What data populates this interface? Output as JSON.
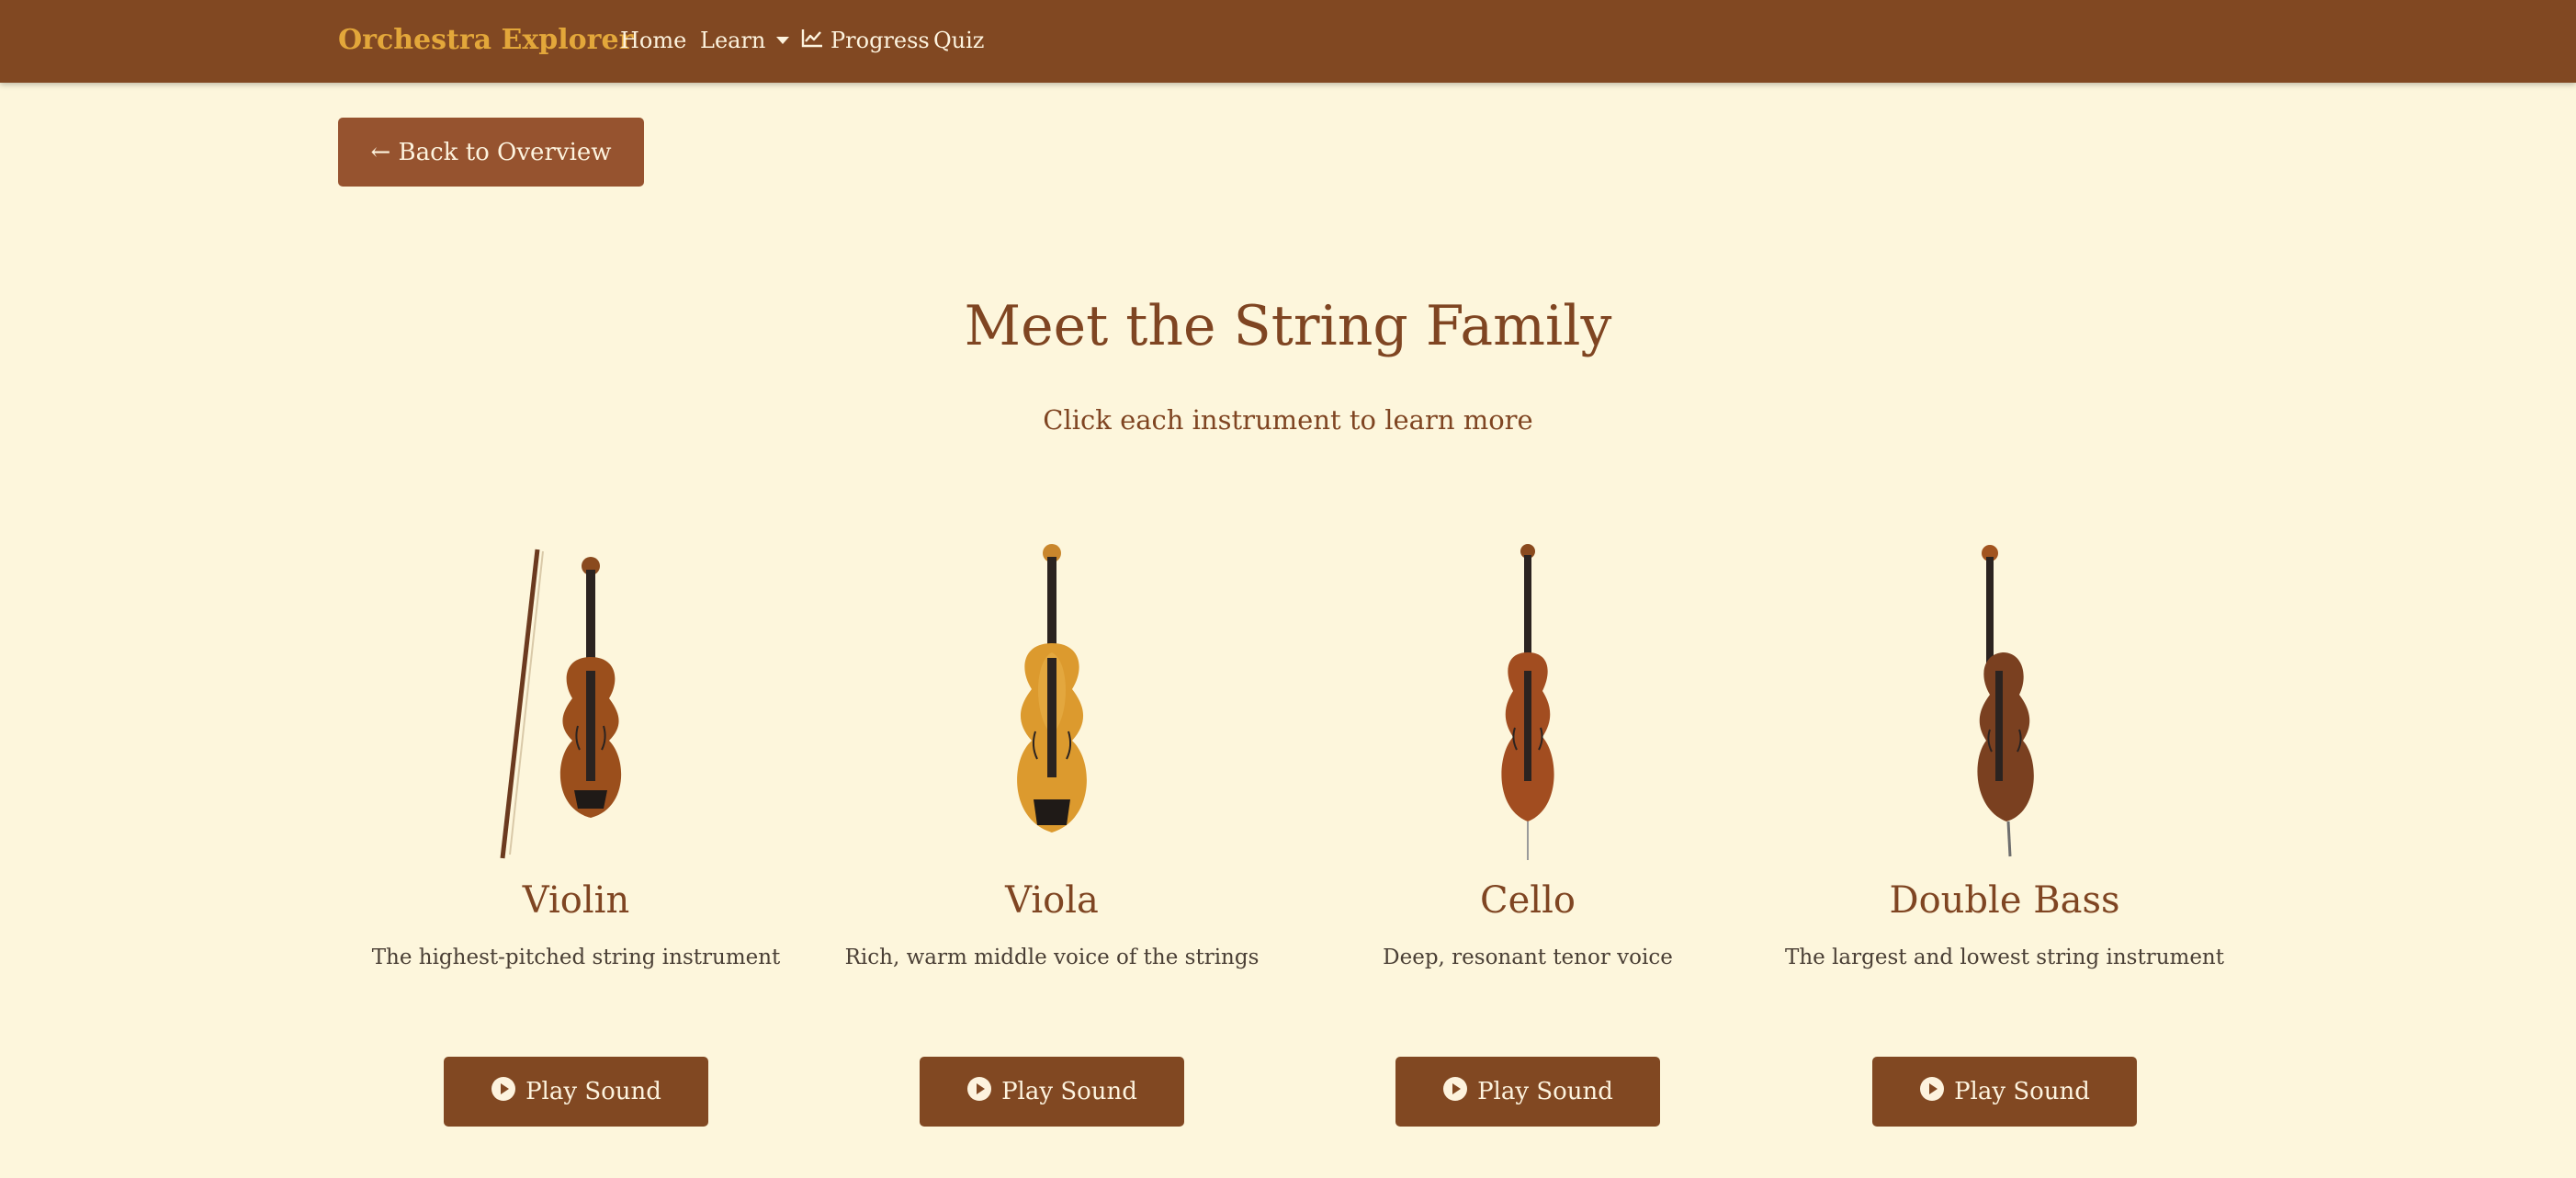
{
  "nav": {
    "brand": "Orchestra Explorer",
    "home": "Home",
    "learn": "Learn",
    "progress": "Progress",
    "quiz": "Quiz"
  },
  "back_button": "← Back to Overview",
  "title": "Meet the String Family",
  "subtitle": "Click each instrument to learn more",
  "play_label": "Play Sound",
  "instruments": [
    {
      "name": "Violin",
      "description": "The highest-pitched string instrument"
    },
    {
      "name": "Viola",
      "description": "Rich, warm middle voice of the strings"
    },
    {
      "name": "Cello",
      "description": "Deep, resonant tenor voice"
    },
    {
      "name": "Double Bass",
      "description": "The largest and lowest string instrument"
    }
  ],
  "colors": {
    "navbar": "#814822",
    "brand": "#e3a73a",
    "background": "#fdf6dc",
    "button": "#814822",
    "heading": "#7f4522"
  },
  "icons": {
    "progress": "chart-line-icon",
    "play": "play-circle-icon",
    "dropdown": "caret-down-icon"
  }
}
